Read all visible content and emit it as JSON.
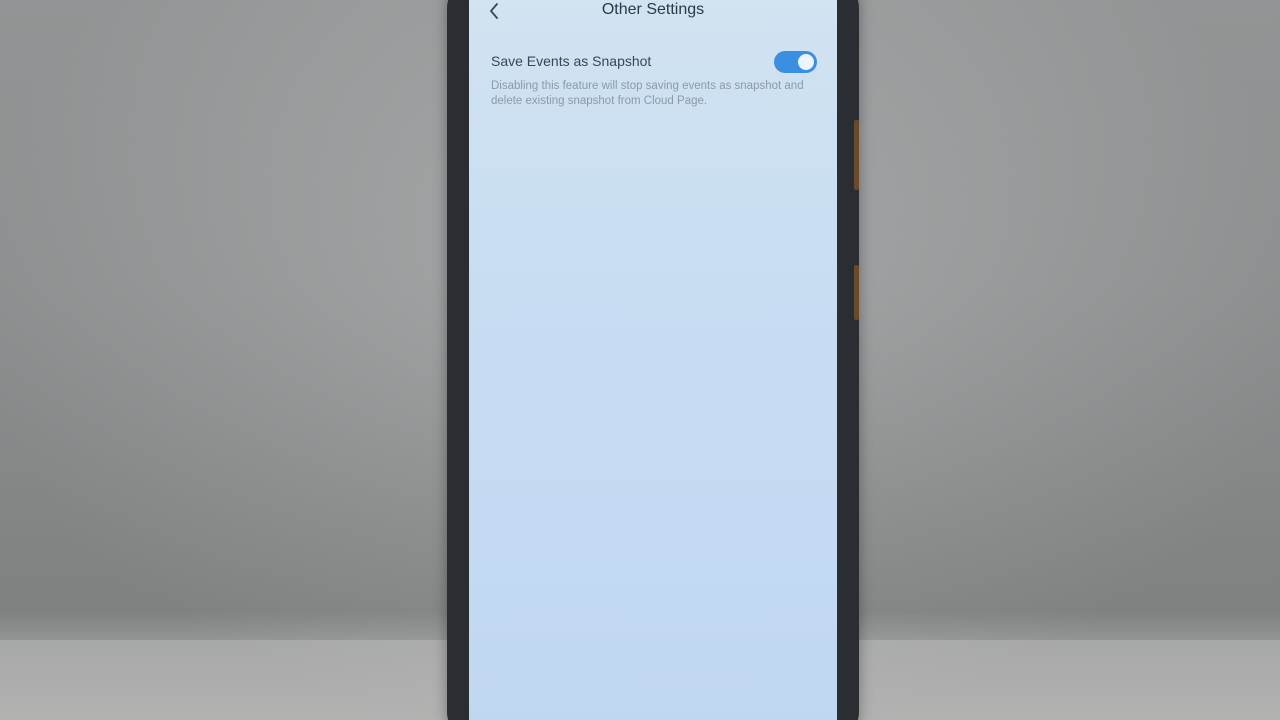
{
  "header": {
    "title": "Other Settings",
    "back_icon": "chevron-left-icon"
  },
  "settings": {
    "snapshot": {
      "label": "Save Events as Snapshot",
      "enabled": true,
      "description": "Disabling this feature will stop saving events as snapshot and delete existing snapshot from Cloud Page."
    }
  },
  "colors": {
    "toggle_on": "#3b8fe3",
    "screen_bg": "#c7ddf2"
  }
}
